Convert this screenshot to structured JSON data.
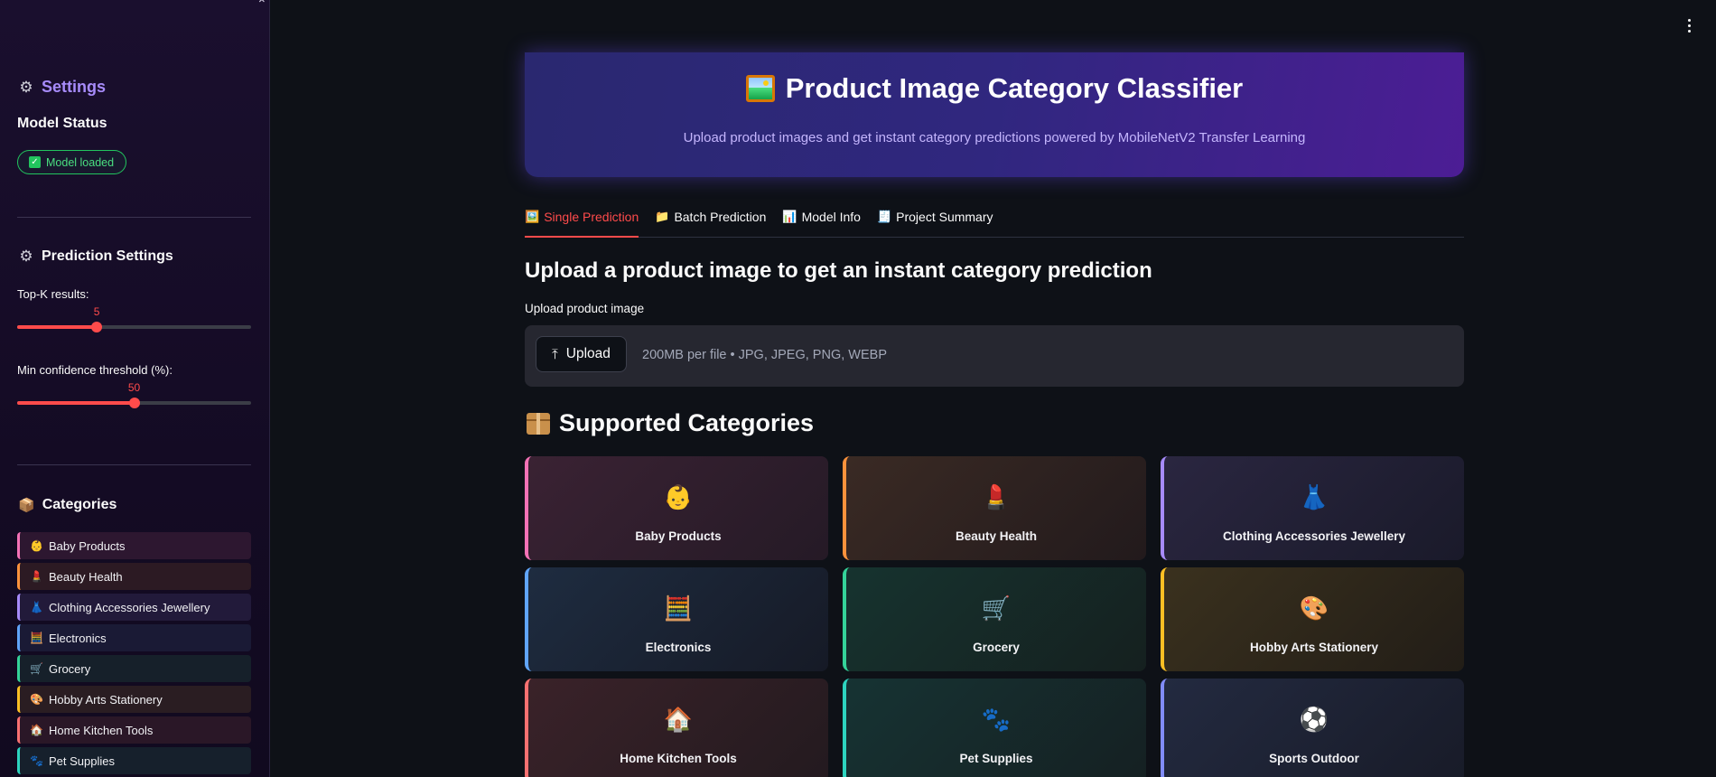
{
  "sidebar": {
    "settings_title": "Settings",
    "model_status_label": "Model Status",
    "model_badge": "Model loaded",
    "prediction_settings_title": "Prediction Settings",
    "topk_label": "Top-K results:",
    "topk_value": "5",
    "topk_fraction": 0.34,
    "conf_label": "Min confidence threshold (%):",
    "conf_value": "50",
    "conf_fraction": 0.5,
    "categories_title": "Categories",
    "categories": [
      {
        "icon": "baby-icon",
        "glyph": "👶",
        "label": "Baby Products",
        "color": "#f472b6",
        "bg": "#2d1730"
      },
      {
        "icon": "lipstick-icon",
        "glyph": "💄",
        "label": "Beauty Health",
        "color": "#fb923c",
        "bg": "#2c1a23"
      },
      {
        "icon": "dress-icon",
        "glyph": "👗",
        "label": "Clothing Accessories Jewellery",
        "color": "#a78bfa",
        "bg": "#221a3a"
      },
      {
        "icon": "calculator-icon",
        "glyph": "🧮",
        "label": "Electronics",
        "color": "#60a5fa",
        "bg": "#1a1a35"
      },
      {
        "icon": "cart-icon",
        "glyph": "🛒",
        "label": "Grocery",
        "color": "#34d399",
        "bg": "#16202a"
      },
      {
        "icon": "palette-icon",
        "glyph": "🎨",
        "label": "Hobby Arts Stationery",
        "color": "#fbbf24",
        "bg": "#2a1d22"
      },
      {
        "icon": "house-icon",
        "glyph": "🏠",
        "label": "Home Kitchen Tools",
        "color": "#f87171",
        "bg": "#2a1727"
      },
      {
        "icon": "paws-icon",
        "glyph": "🐾",
        "label": "Pet Supplies",
        "color": "#2dd4bf",
        "bg": "#16202c"
      }
    ]
  },
  "hero": {
    "title": "Product Image Category Classifier",
    "subtitle": "Upload product images and get instant category predictions powered by MobileNetV2 Transfer Learning"
  },
  "tabs": [
    {
      "icon": "picture-icon",
      "glyph": "🖼️",
      "label": "Single Prediction"
    },
    {
      "icon": "folder-icon",
      "glyph": "📁",
      "label": "Batch Prediction"
    },
    {
      "icon": "bar-chart-icon",
      "glyph": "📊",
      "label": "Model Info"
    },
    {
      "icon": "receipt-icon",
      "glyph": "🧾",
      "label": "Project Summary"
    }
  ],
  "main": {
    "section_title": "Upload a product image to get an instant category prediction",
    "upload_label": "Upload product image",
    "upload_button": "Upload",
    "upload_hint": "200MB per file • JPG, JPEG, PNG, WEBP",
    "supported_title": "Supported Categories"
  },
  "cards": [
    {
      "icon": "baby-icon",
      "glyph": "👶",
      "label": "Baby Products",
      "color": "#f472b6",
      "bg": "linear-gradient(135deg,#3a2233 0%,#251a26 100%)"
    },
    {
      "icon": "lipstick-icon",
      "glyph": "💄",
      "label": "Beauty Health",
      "color": "#fb923c",
      "bg": "linear-gradient(135deg,#3a2a24 0%,#221a1c 100%)"
    },
    {
      "icon": "dress-icon",
      "glyph": "👗",
      "label": "Clothing Accessories Jewellery",
      "color": "#a78bfa",
      "bg": "linear-gradient(135deg,#2a2640 0%,#1a1a2a 100%)"
    },
    {
      "icon": "calculator-icon",
      "glyph": "🧮",
      "label": "Electronics",
      "color": "#60a5fa",
      "bg": "linear-gradient(135deg,#1e2c40 0%,#161a26 100%)"
    },
    {
      "icon": "cart-icon",
      "glyph": "🛒",
      "label": "Grocery",
      "color": "#34d399",
      "bg": "linear-gradient(135deg,#16332f 0%,#15201f 100%)"
    },
    {
      "icon": "palette-icon",
      "glyph": "🎨",
      "label": "Hobby Arts Stationery",
      "color": "#fbbf24",
      "bg": "linear-gradient(135deg,#3a311e 0%,#221d17 100%)"
    },
    {
      "icon": "house-icon",
      "glyph": "🏠",
      "label": "Home Kitchen Tools",
      "color": "#f87171",
      "bg": "linear-gradient(135deg,#3a2229 0%,#231a1f 100%)"
    },
    {
      "icon": "paws-icon",
      "glyph": "🐾",
      "label": "Pet Supplies",
      "color": "#2dd4bf",
      "bg": "linear-gradient(135deg,#163333 0%,#152022 100%)"
    },
    {
      "icon": "soccer-ball-icon",
      "glyph": "⚽",
      "label": "Sports Outdoor",
      "color": "#818cf8",
      "bg": "linear-gradient(135deg,#232a40 0%,#181b28 100%)"
    }
  ],
  "colors": {
    "accent": "#ff4b4b",
    "badge_green": "#22c55e",
    "settings_purple": "#a78bfa"
  }
}
